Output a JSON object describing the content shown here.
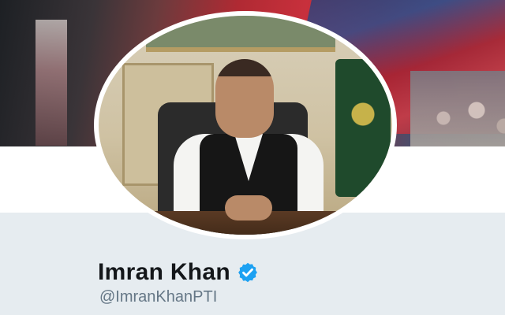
{
  "profile": {
    "display_name": "Imran Khan",
    "handle": "@ImranKhanPTI",
    "verified": true
  },
  "icons": {
    "verified": "verified-badge-icon"
  },
  "colors": {
    "verified_blue": "#1da1f2",
    "name_text": "#14171a",
    "handle_text": "#657786",
    "page_background": "#e6ecf0"
  }
}
